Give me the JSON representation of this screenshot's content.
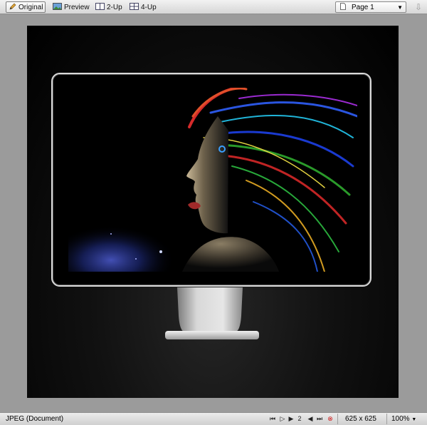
{
  "toolbar": {
    "tabs": [
      {
        "label": "Original",
        "icon": "pencil-icon",
        "active": true
      },
      {
        "label": "Preview",
        "icon": "image-icon",
        "active": false
      },
      {
        "label": "2-Up",
        "icon": "two-up-icon",
        "active": false
      },
      {
        "label": "4-Up",
        "icon": "four-up-icon",
        "active": false
      }
    ],
    "page_select": {
      "value": "Page 1",
      "icon": "document-icon"
    },
    "optimize_icon": "optimize-arrows-icon"
  },
  "canvas": {
    "image_description": "monitor-with-rainbow-hair-portrait"
  },
  "statusbar": {
    "format": "JPEG (Document)",
    "frame_number": "2",
    "dimensions": "625 x 625",
    "zoom": "100%"
  },
  "colors": {
    "toolbar_bg": "#dedede",
    "canvas_bg": "#0a0a0a",
    "workspace_bg": "#9b9b9b",
    "stop_icon": "#d11a1a"
  }
}
